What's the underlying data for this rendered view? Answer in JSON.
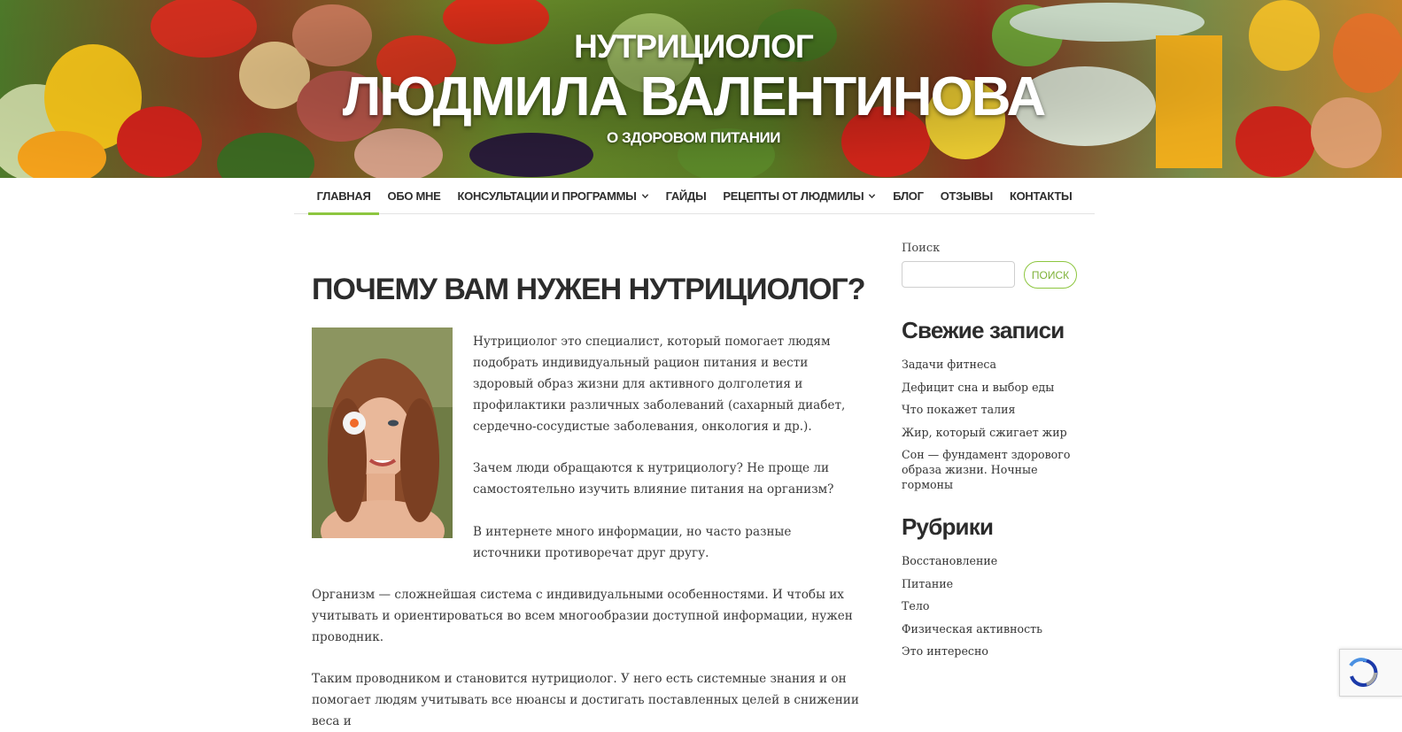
{
  "header": {
    "title_small": "НУТРИЦИОЛОГ",
    "title_big": "ЛЮДМИЛА ВАЛЕНТИНОВА",
    "tagline": "О ЗДОРОВОМ ПИТАНИИ"
  },
  "nav": {
    "items": [
      {
        "label": "ГЛАВНАЯ",
        "active": true,
        "has_dropdown": false
      },
      {
        "label": "ОБО МНЕ",
        "active": false,
        "has_dropdown": false
      },
      {
        "label": "КОНСУЛЬТАЦИИ И ПРОГРАММЫ",
        "active": false,
        "has_dropdown": true
      },
      {
        "label": "ГАЙДЫ",
        "active": false,
        "has_dropdown": false
      },
      {
        "label": "РЕЦЕПТЫ ОТ ЛЮДМИЛЫ",
        "active": false,
        "has_dropdown": true
      },
      {
        "label": "БЛОГ",
        "active": false,
        "has_dropdown": false
      },
      {
        "label": "ОТЗЫВЫ",
        "active": false,
        "has_dropdown": false
      },
      {
        "label": "КОНТАКТЫ",
        "active": false,
        "has_dropdown": false
      }
    ],
    "accent_color": "#8dc63f"
  },
  "post": {
    "title": "ПОЧЕМУ ВАМ НУЖЕН НУТРИЦИОЛОГ?",
    "paragraphs": [
      "Нутрициолог это специалист, который помогает людям подобрать индивидуальный рацион питания и вести здоровый образ жизни для активного долголетия и профилактики различных заболеваний (сахарный диабет, сердечно-сосудистые заболевания, онкология и др.).",
      "Зачем люди обращаются к нутрициологу? Не проще ли самостоятельно изучить влияние питания на организм?",
      "В интернете много информации, но часто разные источники противоречат друг другу.",
      "Организм — сложнейшая система с индивидуальными особенностями. И чтобы их учитывать и ориентироваться во всем многообразии доступной информации, нужен проводник.",
      "Таким проводником и становится нутрициолог. У него есть системные знания и он помогает людям учитывать все нюансы и достигать поставленных целей в снижении веса и"
    ]
  },
  "sidebar": {
    "search_label": "Поиск",
    "search_value": "",
    "search_button": "ПОИСК",
    "recent_title": "Свежие записи",
    "recent_posts": [
      "Задачи фитнеса",
      "Дефицит сна и выбор еды",
      "Что покажет талия",
      "Жир, который сжигает жир",
      "Сон — фундамент здорового образа жизни. Ночные гормоны"
    ],
    "categories_title": "Рубрики",
    "categories": [
      "Восстановление",
      "Питание",
      "Тело",
      "Физическая активность",
      "Это интересно"
    ]
  },
  "icons": {
    "dropdown": "chevron-down-icon",
    "recaptcha": "recaptcha-icon"
  }
}
